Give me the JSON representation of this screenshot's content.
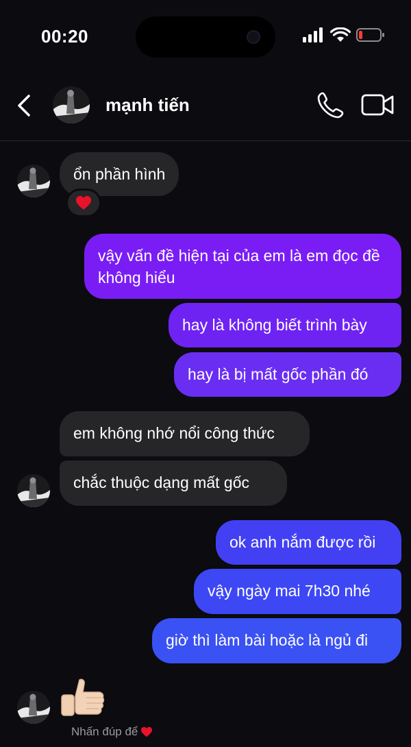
{
  "status": {
    "time": "00:20"
  },
  "header": {
    "contact_name": "mạnh tiến"
  },
  "messages": [
    {
      "from": "them",
      "text": "ổn phần hình"
    },
    {
      "from": "me",
      "text": "vậy vấn đề hiện tại của em là em đọc đề không hiểu"
    },
    {
      "from": "me",
      "text": "hay là không biết trình bày"
    },
    {
      "from": "me",
      "text": "hay là bị mất gốc phần đó"
    },
    {
      "from": "them",
      "text": "em không nhớ nổi công thức"
    },
    {
      "from": "them",
      "text": "chắc thuộc dạng mất gốc"
    },
    {
      "from": "me",
      "text": "ok anh nắm được rồi"
    },
    {
      "from": "me",
      "text": "vậy ngày mai 7h30 nhé"
    },
    {
      "from": "me",
      "text": "giờ thì làm bài hoặc là ngủ đi"
    }
  ],
  "reaction": {
    "emoji": "heart"
  },
  "last": {
    "sticker": "thumbs-up",
    "hint": "Nhấn đúp để"
  },
  "colors": {
    "background": "#0b0b10",
    "received_bubble": "#262629",
    "sent_purple": "#7a1df5",
    "sent_blue": "#3a52f3",
    "heart": "#e8132a"
  }
}
